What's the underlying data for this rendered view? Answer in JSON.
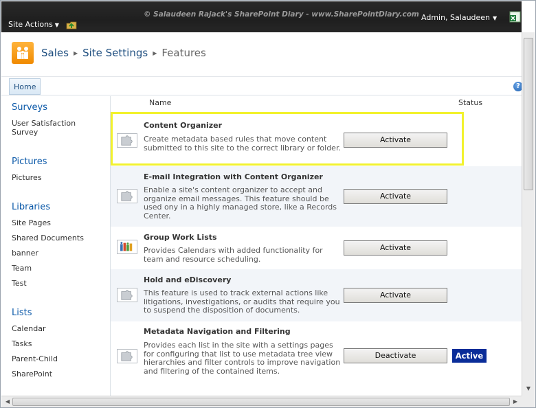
{
  "topbar": {
    "site_actions": "Site Actions",
    "watermark": "© Salaudeen Rajack's SharePoint Diary - www.SharePointDiary.com",
    "user": "Admin, Salaudeen"
  },
  "breadcrumb": {
    "site": "Sales",
    "section": "Site Settings",
    "current": "Features"
  },
  "topnav": {
    "home": "Home"
  },
  "leftnav": {
    "groups": [
      {
        "heading": "Surveys",
        "items": [
          "User Satisfaction Survey"
        ]
      },
      {
        "heading": "Pictures",
        "items": [
          "Pictures"
        ]
      },
      {
        "heading": "Libraries",
        "items": [
          "Site Pages",
          "Shared Documents",
          "banner",
          "Team",
          "Test"
        ]
      },
      {
        "heading": "Lists",
        "items": [
          "Calendar",
          "Tasks",
          "Parent-Child",
          "SharePoint"
        ]
      }
    ]
  },
  "list": {
    "col_name": "Name",
    "col_status": "Status",
    "features": [
      {
        "title": "Content Organizer",
        "description": "Create metadata based rules that move content submitted to this site to the correct library or folder.",
        "button": "Activate",
        "status": ""
      },
      {
        "title": "E-mail Integration with Content Organizer",
        "description": "Enable a site's content organizer to accept and organize email messages. This feature should be used ony in a highly managed store, like a Records Center.",
        "button": "Activate",
        "status": ""
      },
      {
        "title": "Group Work Lists",
        "description": "Provides Calendars with added functionality for team and resource scheduling.",
        "button": "Activate",
        "status": ""
      },
      {
        "title": "Hold and eDiscovery",
        "description": "This feature is used to track external actions like litigations, investigations, or audits that require you to suspend the disposition of documents.",
        "button": "Activate",
        "status": ""
      },
      {
        "title": "Metadata Navigation and Filtering",
        "description": "Provides each list in the site with a settings pages for configuring that list to use metadata tree view hierarchies and filter controls to improve navigation and filtering of the contained items.",
        "button": "Deactivate",
        "status": "Active"
      }
    ]
  },
  "colors": {
    "highlight": "#f2f22e",
    "active_badge": "#0a2d99",
    "link": "#0a58a8"
  }
}
